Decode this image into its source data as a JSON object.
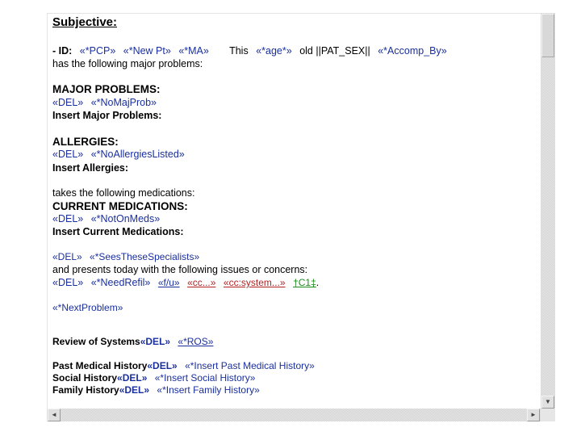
{
  "document": {
    "subjective_heading": "Subjective:",
    "id_line": {
      "prefix": "- ID:",
      "pcp": "«*PCP»",
      "new_pt": "«*New Pt»",
      "ma": "«*MA»",
      "this_text": "This",
      "age": "«*age*»",
      "old_text": "old ||PAT_SEX||",
      "accomp_by": "«*Accomp_By»"
    },
    "major_problems_intro": "has the following major problems:",
    "major_problems": {
      "heading": "MAJOR PROBLEMS:",
      "del": "«DEL»",
      "field": "«*NoMajProb»",
      "insert": "Insert Major Problems:"
    },
    "allergies": {
      "heading": "ALLERGIES:",
      "del": "«DEL»",
      "field": "«*NoAllergiesListed»",
      "insert": "Insert Allergies:"
    },
    "medications_intro": "takes the following medications:",
    "current_medications": {
      "heading": "CURRENT MEDICATIONS:",
      "del": "«DEL»",
      "field": "«*NotOnMeds»",
      "insert": "Insert Current Medications:"
    },
    "specialists": {
      "del": "«DEL»",
      "field": "«*SeesTheseSpecialists»"
    },
    "issues_intro": "and presents today with the following issues or concerns:",
    "refill": {
      "del": "«DEL»",
      "field": "«*NeedRefil»",
      "fu": "«f/u»",
      "cc": "«cc...»",
      "cc_system": "«cc:system...»",
      "c1": "†C1‡",
      "trailing": "."
    },
    "next_problem": "«*NextProblem»",
    "review_of_systems": {
      "label": "Review of Systems",
      "del": "«DEL»",
      "field": "«*ROS»"
    },
    "past_medical_history": {
      "label": "Past Medical History",
      "del": "«DEL»",
      "field": "«*Insert Past Medical History»"
    },
    "social_history": {
      "label": "Social History",
      "del": "«DEL»",
      "field": "«*Insert Social History»"
    },
    "family_history": {
      "label": "Family History",
      "del": "«DEL»",
      "field": "«*Insert Family History»"
    }
  },
  "scrollbars": {
    "up_arrow": "▲",
    "down_arrow": "▼",
    "left_arrow": "◄",
    "right_arrow": "►"
  }
}
